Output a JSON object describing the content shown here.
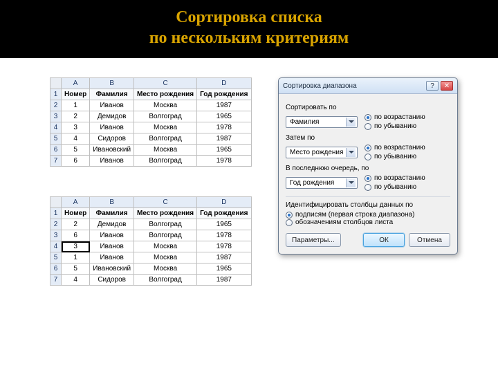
{
  "slide": {
    "title_line1": "Сортировка списка",
    "title_line2": "по нескольким критериям"
  },
  "columns": [
    "A",
    "B",
    "C",
    "D"
  ],
  "headers": {
    "num": "Номер",
    "surname": "Фамилия",
    "place": "Место рождения",
    "year": "Год рождения"
  },
  "table1": [
    {
      "n": "1",
      "s": "Иванов",
      "p": "Москва",
      "y": "1987"
    },
    {
      "n": "2",
      "s": "Демидов",
      "p": "Волгоград",
      "y": "1965"
    },
    {
      "n": "3",
      "s": "Иванов",
      "p": "Москва",
      "y": "1978"
    },
    {
      "n": "4",
      "s": "Сидоров",
      "p": "Волгоград",
      "y": "1987"
    },
    {
      "n": "5",
      "s": "Ивановский",
      "p": "Москва",
      "y": "1965"
    },
    {
      "n": "6",
      "s": "Иванов",
      "p": "Волгоград",
      "y": "1978"
    }
  ],
  "table2": [
    {
      "n": "2",
      "s": "Демидов",
      "p": "Волгоград",
      "y": "1965"
    },
    {
      "n": "6",
      "s": "Иванов",
      "p": "Волгоград",
      "y": "1978"
    },
    {
      "n": "3",
      "s": "Иванов",
      "p": "Москва",
      "y": "1978"
    },
    {
      "n": "1",
      "s": "Иванов",
      "p": "Москва",
      "y": "1987"
    },
    {
      "n": "5",
      "s": "Ивановский",
      "p": "Москва",
      "y": "1965"
    },
    {
      "n": "4",
      "s": "Сидоров",
      "p": "Волгоград",
      "y": "1987"
    }
  ],
  "dialog": {
    "title": "Сортировка диапазона",
    "sortby_label": "Сортировать по",
    "sortby_value": "Фамилия",
    "then_label": "Затем по",
    "then_value": "Место рождения",
    "last_label": "В последнюю очередь, по",
    "last_value": "Год рождения",
    "asc": "по возрастанию",
    "desc": "по убыванию",
    "identify_label": "Идентифицировать столбцы данных по",
    "identify_labels": "подписям (первая строка диапазона)",
    "identify_cols": "обозначениям столбцов листа",
    "params": "Параметры...",
    "ok": "ОК",
    "cancel": "Отмена",
    "help_glyph": "?",
    "close_glyph": "✕"
  }
}
